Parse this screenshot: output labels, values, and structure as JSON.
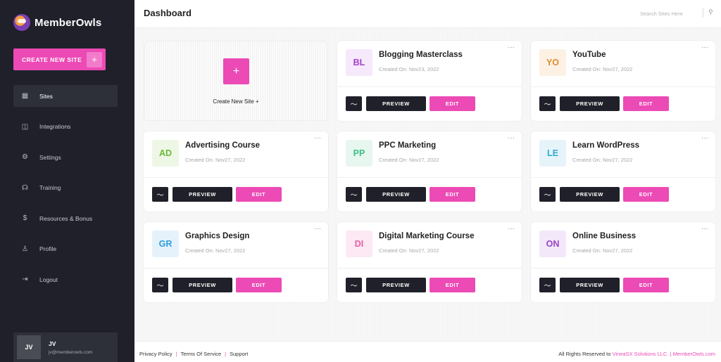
{
  "brand": {
    "name": "MemberOwls"
  },
  "sidebar": {
    "create_label": "CREATE NEW SITE",
    "create_plus": "+",
    "items": [
      {
        "label": "Sites",
        "icon": "calendar-icon",
        "glyph": "▦",
        "active": true
      },
      {
        "label": "Integrations",
        "icon": "plug-icon",
        "glyph": "◫",
        "active": false
      },
      {
        "label": "Settings",
        "icon": "gear-icon",
        "glyph": "⚙",
        "active": false
      },
      {
        "label": "Training",
        "icon": "headset-icon",
        "glyph": "☊",
        "active": false
      },
      {
        "label": "Resources & Bonus",
        "icon": "dollar-icon",
        "glyph": "$",
        "active": false
      },
      {
        "label": "Profile",
        "icon": "user-icon",
        "glyph": "♙",
        "active": false
      },
      {
        "label": "Logout",
        "icon": "logout-icon",
        "glyph": "⇥",
        "active": false
      }
    ],
    "user": {
      "initials": "JV",
      "name": "JV",
      "email": "jv@memberowls.com"
    }
  },
  "header": {
    "title": "Dashboard",
    "search_placeholder": "Search Sites Here"
  },
  "new_site_card": {
    "plus": "+",
    "label": "Create New Site +"
  },
  "card_labels": {
    "preview": "PREVIEW",
    "edit": "EDIT",
    "more": "···",
    "stats_glyph": "〜"
  },
  "sites": [
    {
      "initials": "BL",
      "name": "Blogging Masterclass",
      "created": "Created On: Nov23, 2022",
      "color": "#a63fc9",
      "bg": "#f5e9fb"
    },
    {
      "initials": "YO",
      "name": "YouTube",
      "created": "Created On: Nov27, 2022",
      "color": "#e08a2e",
      "bg": "#fdf1e4"
    },
    {
      "initials": "AD",
      "name": "Advertising Course",
      "created": "Created On: Nov27, 2022",
      "color": "#6ab935",
      "bg": "#eef7e6"
    },
    {
      "initials": "PP",
      "name": "PPC Marketing",
      "created": "Created On: Nov27, 2022",
      "color": "#3ebf86",
      "bg": "#e7f7ef"
    },
    {
      "initials": "LE",
      "name": "Learn WordPress",
      "created": "Created On: Nov27, 2022",
      "color": "#2fa9d6",
      "bg": "#e6f4fa"
    },
    {
      "initials": "GR",
      "name": "Graphics Design",
      "created": "Created On: Nov27, 2022",
      "color": "#2d9fe0",
      "bg": "#e6f2fb"
    },
    {
      "initials": "DI",
      "name": "Digital Marketing Course",
      "created": "Created On: Nov27, 2022",
      "color": "#ec5ca6",
      "bg": "#fce9f3"
    },
    {
      "initials": "ON",
      "name": "Online Business",
      "created": "Created On: Nov27, 2022",
      "color": "#9a43c9",
      "bg": "#f3e7fa"
    }
  ],
  "footer": {
    "privacy": "Privacy Policy",
    "terms": "Terms Of Service",
    "support": "Support",
    "sep": "|",
    "rights_prefix": "All Rights Reserved to",
    "company": "VineaSX Solutions LLC.",
    "site": "MemberOwls.com"
  }
}
